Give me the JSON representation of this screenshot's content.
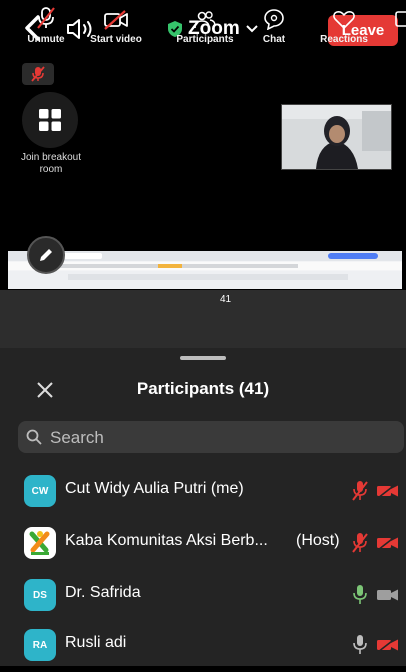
{
  "header": {
    "app_title": "Zoom",
    "leave_label": "Leave"
  },
  "video": {
    "breakout_label": "Join breakout room"
  },
  "toolbar": {
    "items": [
      {
        "label": "Unmute"
      },
      {
        "label": "Start video"
      },
      {
        "label": "Participants"
      },
      {
        "label": "Chat"
      },
      {
        "label": "Reactions"
      }
    ],
    "participants_count": "41"
  },
  "participants_panel": {
    "title": "Participants (41)",
    "search_placeholder": "Search",
    "participants": [
      {
        "initials": "CW",
        "name": "Cut Widy Aulia Putri (me)",
        "role": "",
        "avatar_color": "#2eb4c9",
        "mic": "muted",
        "video": "off"
      },
      {
        "initials": "",
        "name": "Kaba Komunitas Aksi Berb...",
        "role": "(Host)",
        "avatar_color": "#ffffff",
        "mic": "muted",
        "video": "off"
      },
      {
        "initials": "DS",
        "name": "Dr. Safrida",
        "role": "",
        "avatar_color": "#2eb4c9",
        "mic": "on",
        "video": "on"
      },
      {
        "initials": "RA",
        "name": "Rusli adi",
        "role": "",
        "avatar_color": "#2eb4c9",
        "mic": "on",
        "video": "off"
      }
    ]
  },
  "colors": {
    "leave": "#e53935",
    "muted_red": "#e53935",
    "mic_green": "#7cc576",
    "shield_green": "#36c36b"
  }
}
